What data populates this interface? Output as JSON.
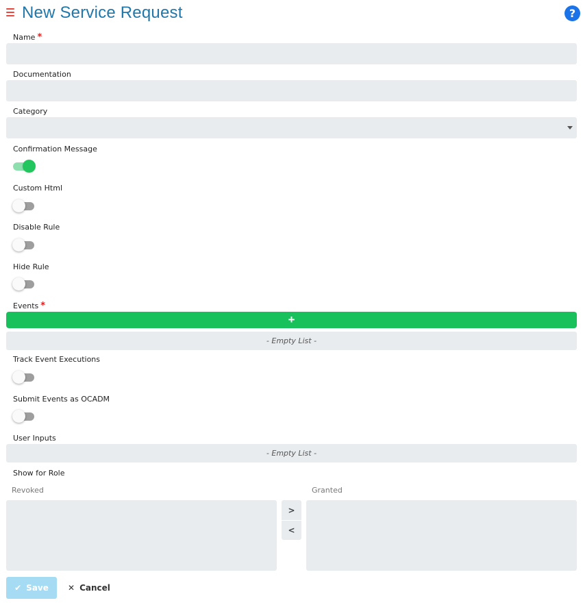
{
  "header": {
    "title": "New Service Request",
    "menu_icon": "hamburger-menu-icon",
    "help_icon": "question-circle-icon",
    "help_glyph": "?"
  },
  "colors": {
    "title": "#2277aa",
    "menu": "#e8453c",
    "help": "#1a73e8",
    "toggle_on": "#22c55e",
    "add_button": "#19c15d",
    "save_button_disabled": "#a6dcf3",
    "required": "#e02020"
  },
  "form": {
    "required_marker": "*",
    "name": {
      "label": "Name",
      "value": "",
      "required": true
    },
    "documentation": {
      "label": "Documentation",
      "value": ""
    },
    "category": {
      "label": "Category",
      "selected": ""
    },
    "confirmation_message": {
      "label": "Confirmation Message",
      "enabled": true
    },
    "custom_html": {
      "label": "Custom Html",
      "enabled": false
    },
    "disable_rule": {
      "label": "Disable Rule",
      "enabled": false
    },
    "hide_rule": {
      "label": "Hide Rule",
      "enabled": false
    },
    "events": {
      "label": "Events",
      "required": true,
      "add_glyph": "+",
      "empty_text": "- Empty List -"
    },
    "track_event_executions": {
      "label": "Track Event Executions",
      "enabled": false
    },
    "submit_events_as_ocadm": {
      "label": "Submit Events as OCADM",
      "enabled": false
    },
    "user_inputs": {
      "label": "User Inputs",
      "empty_text": "- Empty List -"
    },
    "show_for_role": {
      "label": "Show for Role",
      "revoked_label": "Revoked",
      "granted_label": "Granted",
      "move_right_glyph": ">",
      "move_left_glyph": "<",
      "revoked_items": [],
      "granted_items": []
    }
  },
  "actions": {
    "save_label": "Save",
    "save_glyph": "✔",
    "save_disabled": true,
    "cancel_label": "Cancel",
    "cancel_glyph": "✕"
  }
}
